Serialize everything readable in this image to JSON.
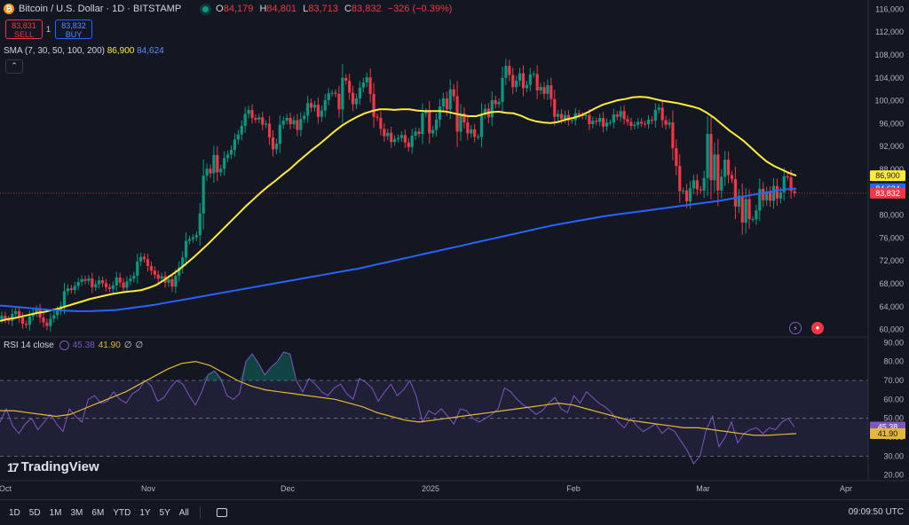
{
  "header": {
    "title": "Bitcoin / U.S. Dollar · 1D · BITSTAMP",
    "icon": "bitcoin-icon",
    "ohlc": [
      {
        "k": "O",
        "v": "84,179"
      },
      {
        "k": "H",
        "v": "84,801"
      },
      {
        "k": "L",
        "v": "83,713"
      },
      {
        "k": "C",
        "v": "83,832"
      },
      {
        "k": "",
        "v": "−326 (−0.39%)"
      }
    ]
  },
  "trade": {
    "sell_price": "83,831",
    "sell_label": "SELL",
    "spread": "1",
    "buy_price": "83,832",
    "buy_label": "BUY"
  },
  "sma": {
    "label": "SMA (7, 30, 50, 100, 200)",
    "v1": "86,900",
    "v2": "84,624"
  },
  "collapse_glyph": "⌃",
  "rsi": {
    "label": "RSI 14 close",
    "v1": "45.38",
    "v2": "41.90",
    "v3": "∅",
    "v4": "∅"
  },
  "brand": {
    "name": "TradingView",
    "mark": "17"
  },
  "toolbar": {
    "timeframes": [
      "1D",
      "5D",
      "1M",
      "3M",
      "6M",
      "YTD",
      "1Y",
      "5Y",
      "All"
    ],
    "clock": "09:09:50 UTC"
  },
  "colors": {
    "up": "#089981",
    "down": "#f23645",
    "sma30": "#ffeb3b",
    "sma200": "#2962ff",
    "rsi": "#7e57c2",
    "rsi_ma": "#e3b73c"
  },
  "chart_data": [
    {
      "type": "line",
      "name": "price",
      "x_labels": [
        "Oct",
        "Nov",
        "Dec",
        "2025",
        "Feb",
        "Mar",
        "Apr"
      ],
      "y_ticks": [
        "116,000",
        "112,000",
        "108,000",
        "104,000",
        "100,000",
        "96,000",
        "92,000",
        "88,000",
        "84,000",
        "80,000",
        "76,000",
        "72,000",
        "68,000",
        "64,000",
        "60,000"
      ],
      "ylim": [
        59000,
        117000
      ],
      "price_labels": [
        {
          "text": "86,900",
          "value": 86900,
          "color": "#ffeb3b"
        },
        {
          "text": "84,624",
          "value": 84624,
          "color": "#2962ff"
        },
        {
          "text": "83,832",
          "value": 83832,
          "color": "#f23645"
        }
      ],
      "close_series": [
        62400,
        61800,
        61500,
        62700,
        63200,
        62100,
        61000,
        60800,
        62300,
        62900,
        63500,
        62100,
        61200,
        60600,
        61900,
        62500,
        63300,
        64100,
        66700,
        67200,
        66900,
        67600,
        68300,
        68800,
        68500,
        68900,
        67400,
        67900,
        68600,
        68100,
        67400,
        67100,
        67700,
        69100,
        68200,
        67300,
        68400,
        68900,
        69400,
        71900,
        72700,
        72300,
        71100,
        70300,
        69600,
        68900,
        69300,
        68200,
        68800,
        67500,
        69400,
        70900,
        72600,
        75500,
        75800,
        76100,
        76500,
        80300,
        86900,
        88100,
        87300,
        90500,
        87500,
        88100,
        90000,
        90600,
        91400,
        93200,
        94100,
        95600,
        97700,
        98400,
        97000,
        96700,
        97100,
        95800,
        96000,
        93600,
        91500,
        92500,
        95800,
        96500,
        97000,
        95900,
        96600,
        94900,
        96800,
        97400,
        99600,
        98800,
        99300,
        97200,
        98300,
        100100,
        101300,
        101400,
        101200,
        98500,
        104000,
        103500,
        101400,
        99400,
        100400,
        102300,
        103200,
        104100,
        101200,
        97200,
        97000,
        95100,
        93800,
        94400,
        92800,
        93300,
        93500,
        94000,
        92700,
        91900,
        93900,
        94600,
        94200,
        97800,
        98100,
        94300,
        94900,
        96700,
        99000,
        100400,
        98500,
        102000,
        100800,
        94600,
        97800,
        96200,
        94300,
        95000,
        93700,
        93700,
        97700,
        98600,
        97100,
        100100,
        99400,
        99800,
        104000,
        106100,
        104500,
        102400,
        103500,
        104800,
        102200,
        102800,
        104600,
        104700,
        101800,
        102400,
        101200,
        102700,
        100300,
        97200,
        97700,
        96800,
        97500,
        96500,
        96600,
        97800,
        97500,
        97300,
        97500,
        95900,
        96500,
        96300,
        97000,
        95500,
        96200,
        96200,
        97600,
        97200,
        98200,
        96800,
        96300,
        95600,
        95800,
        96300,
        96000,
        95900,
        96700,
        96500,
        98400,
        98800,
        96600,
        95800,
        96200,
        91700,
        88600,
        84200,
        84300,
        82400,
        84700,
        86100,
        84500,
        84300,
        86500,
        94200,
        86100,
        90600,
        84300,
        86700,
        89700,
        87000,
        86300,
        81500,
        83400,
        78700,
        82800,
        79300,
        79300,
        80800,
        84600,
        82600,
        84000,
        82500,
        85100,
        82900,
        84000,
        86800,
        86600,
        84200,
        83832
      ],
      "sma30_start": 5,
      "sma30": [
        61500,
        61800,
        62000,
        62300,
        62600,
        62900,
        63100,
        63400,
        63700,
        64100,
        64500,
        64900,
        65300,
        65600,
        65900,
        66200,
        66400,
        66600,
        66700,
        66900,
        67300,
        67800,
        68600,
        69500,
        70400,
        71500,
        72600,
        73800,
        75000,
        76300,
        77600,
        78900,
        80200,
        81500,
        82700,
        83900,
        85000,
        86000,
        87100,
        88100,
        89300,
        90400,
        91500,
        92500,
        93600,
        94700,
        95700,
        96500,
        97200,
        97800,
        98200,
        98500,
        98500,
        98400,
        98500,
        98500,
        98300,
        98200,
        98200,
        98200,
        98100,
        97800,
        97500,
        97300,
        97300,
        97700,
        98000,
        98100,
        97900,
        97800,
        97400,
        96800,
        96400,
        96200,
        96100,
        96300,
        96700,
        97000,
        97400,
        98000,
        98700,
        99300,
        99700,
        100100,
        100300,
        100600,
        100700,
        100600,
        100300,
        100000,
        99800,
        99600,
        99300,
        99000,
        98600,
        97900,
        97000,
        95900,
        94800,
        93900,
        92900,
        91700,
        90500,
        89400,
        88600,
        88000,
        87400,
        86900
      ],
      "sma200": [
        64200,
        64000,
        63800,
        63600,
        63400,
        63300,
        63200,
        63200,
        63300,
        63400,
        63700,
        64000,
        64300,
        64700,
        65100,
        65500,
        65900,
        66300,
        66700,
        67100,
        67500,
        67900,
        68300,
        68700,
        69100,
        69500,
        69900,
        70300,
        70700,
        71200,
        71700,
        72200,
        72700,
        73200,
        73700,
        74200,
        74700,
        75200,
        75700,
        76200,
        76700,
        77200,
        77700,
        78200,
        78600,
        79000,
        79400,
        79800,
        80100,
        80400,
        80700,
        81000,
        81300,
        81600,
        81900,
        82200,
        82500,
        82900,
        83300,
        83700,
        84100,
        84500,
        84624
      ]
    },
    {
      "type": "line",
      "name": "RSI 14 close",
      "y_ticks": [
        "90.00",
        "80.00",
        "70.00",
        "60.00",
        "50.00",
        "40.00",
        "30.00",
        "20.00"
      ],
      "ylim": [
        18,
        92
      ],
      "levels": [
        70,
        50,
        30
      ],
      "labels": [
        {
          "text": "45.38",
          "value": 45.38,
          "color": "#7e57c2"
        },
        {
          "text": "41.90",
          "value": 41.9,
          "color": "#e3b73c"
        }
      ],
      "rsi": [
        48,
        55,
        46,
        42,
        47,
        50,
        44,
        48,
        52,
        47,
        43,
        55,
        51,
        48,
        60,
        62,
        58,
        59,
        64,
        60,
        58,
        63,
        65,
        70,
        67,
        59,
        61,
        66,
        70,
        68,
        62,
        57,
        64,
        73,
        75,
        71,
        62,
        60,
        63,
        80,
        84,
        79,
        73,
        77,
        80,
        85,
        84,
        70,
        64,
        71,
        68,
        64,
        62,
        66,
        68,
        63,
        60,
        71,
        69,
        66,
        59,
        64,
        68,
        62,
        65,
        70,
        62,
        48,
        54,
        52,
        55,
        51,
        47,
        55,
        54,
        50,
        48,
        50,
        52,
        55,
        66,
        64,
        60,
        57,
        55,
        52,
        54,
        58,
        61,
        55,
        53,
        62,
        58,
        64,
        61,
        58,
        56,
        53,
        48,
        45,
        50,
        46,
        43,
        45,
        47,
        42,
        45,
        43,
        38,
        33,
        26,
        30,
        44,
        51,
        35,
        40,
        48,
        37,
        42,
        44,
        45,
        42,
        45,
        44,
        48,
        50,
        45.38
      ],
      "rsi_ma": [
        54,
        54,
        53,
        52,
        51,
        52,
        55,
        58,
        61,
        64,
        68,
        72,
        76,
        79,
        80,
        78,
        74,
        70,
        67,
        65,
        64,
        63,
        62,
        61,
        60,
        58,
        56,
        53,
        51,
        49,
        48,
        49,
        50,
        51,
        52,
        53,
        54,
        55,
        56,
        57,
        58,
        57,
        55,
        53,
        51,
        49,
        48,
        47,
        46,
        45,
        45,
        44,
        43,
        42,
        41,
        41,
        41.5,
        41.9
      ]
    }
  ]
}
